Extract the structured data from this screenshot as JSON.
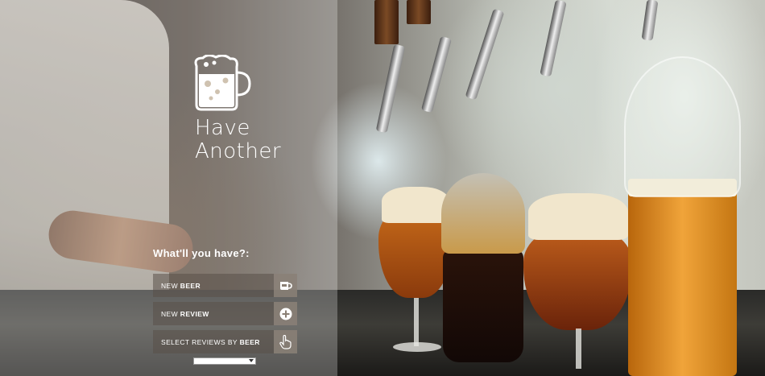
{
  "brand": {
    "line1": "Have",
    "line2": "Another",
    "logo_icon": "beer-mug-icon"
  },
  "menu": {
    "prompt": "What'll you have?:",
    "items": [
      {
        "prefix": "New ",
        "emphasis": "Beer",
        "icon": "beer-label-icon"
      },
      {
        "prefix": "New ",
        "emphasis": "Review",
        "icon": "plus-circle-icon"
      },
      {
        "prefix": "Select Reviews by ",
        "emphasis": "Beer",
        "icon": "pointing-hand-icon"
      }
    ],
    "beer_select": {
      "selected": ""
    }
  },
  "colors": {
    "panel_overlay": "rgba(255,255,255,0.26)",
    "menu_bg": "#5a5048",
    "text": "#ffffff"
  }
}
